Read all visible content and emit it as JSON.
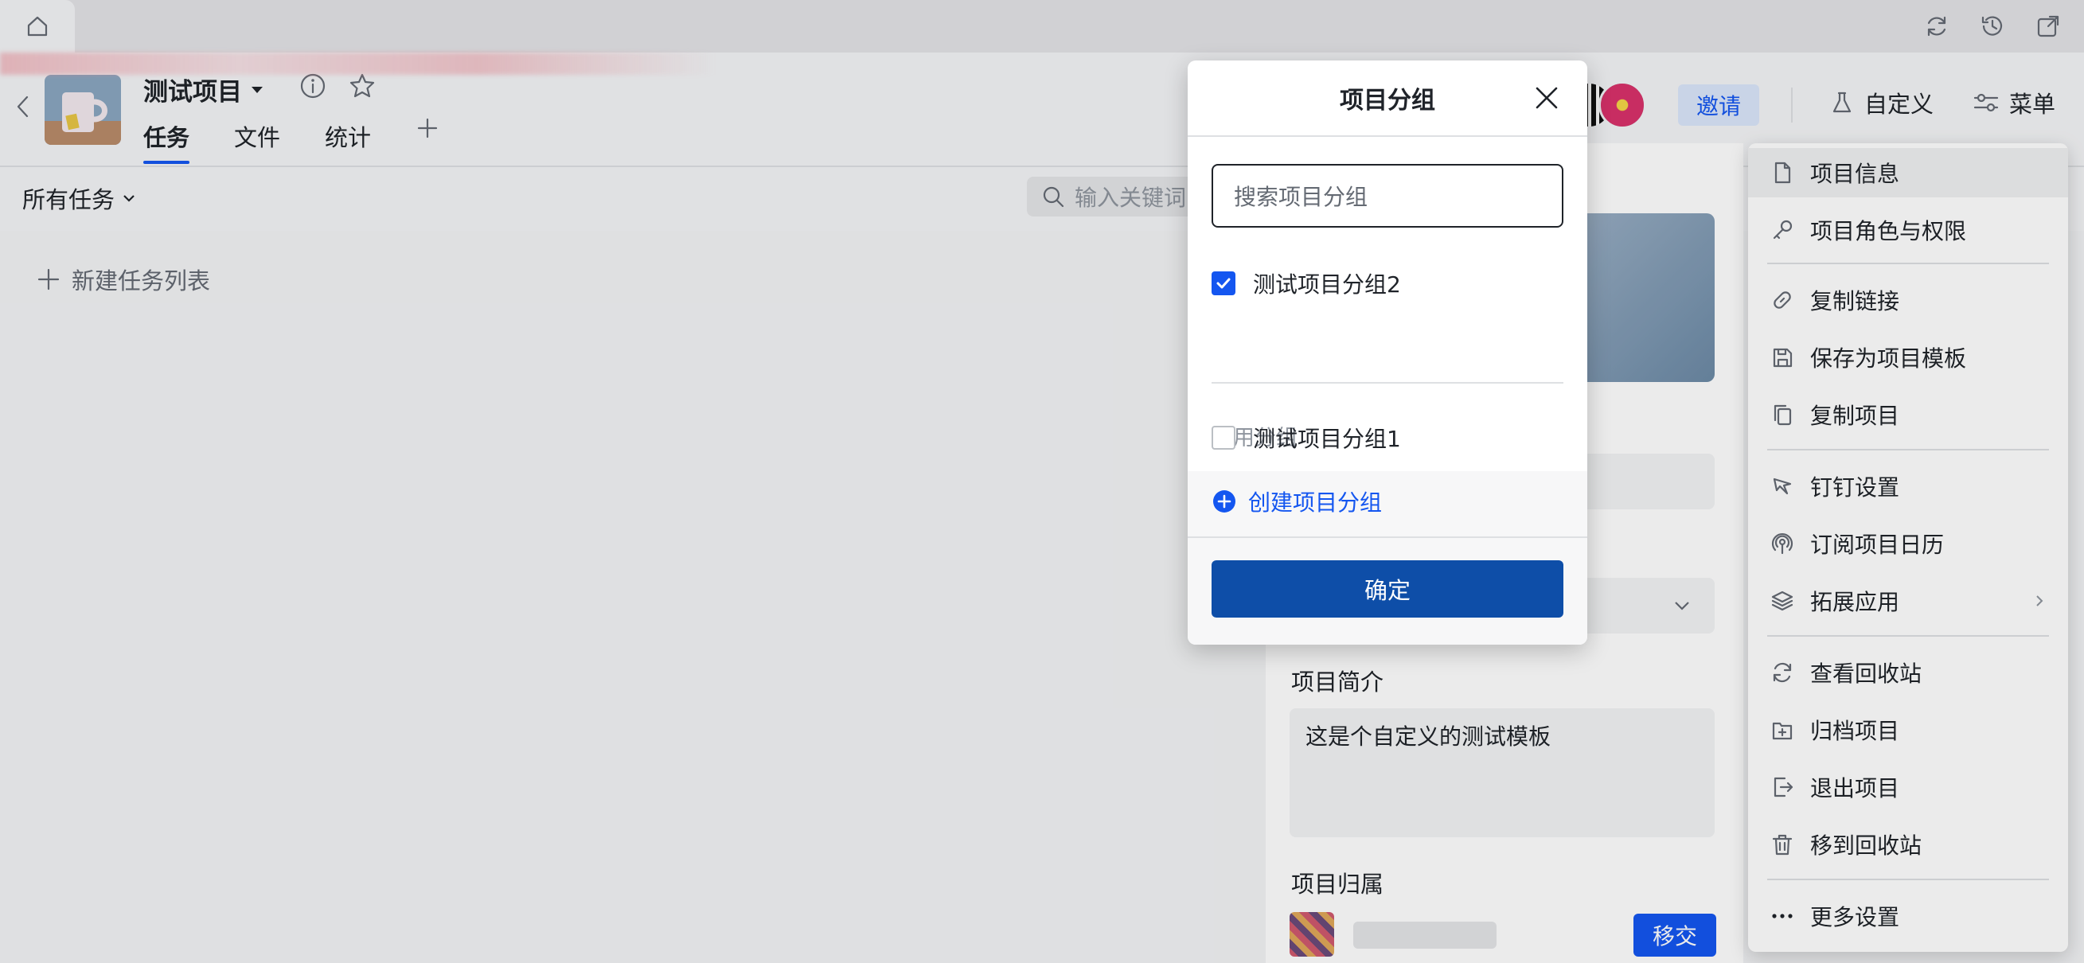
{
  "project": {
    "title": "测试项目",
    "tabs": [
      {
        "label": "任务",
        "active": true
      },
      {
        "label": "文件",
        "active": false
      },
      {
        "label": "统计",
        "active": false
      }
    ]
  },
  "header": {
    "invite_label": "邀请",
    "customize_label": "自定义",
    "menu_label": "菜单"
  },
  "filter": {
    "all_tasks_label": "所有任务",
    "search_placeholder": "输入关键词"
  },
  "board": {
    "new_list_label": "新建任务列表"
  },
  "detail": {
    "intro_label": "项目简介",
    "intro_text": "这是个自定义的测试模板",
    "owner_label": "项目归属",
    "transfer_label": "移交"
  },
  "menu": {
    "items": [
      {
        "label": "项目信息",
        "icon": "file-icon"
      },
      {
        "label": "项目角色与权限",
        "icon": "key-icon"
      },
      {
        "label": "复制链接",
        "icon": "link-icon"
      },
      {
        "label": "保存为项目模板",
        "icon": "save-icon"
      },
      {
        "label": "复制项目",
        "icon": "copy-icon"
      },
      {
        "label": "钉钉设置",
        "icon": "pin-icon"
      },
      {
        "label": "订阅项目日历",
        "icon": "broadcast-icon"
      },
      {
        "label": "拓展应用",
        "icon": "layers-icon"
      },
      {
        "label": "查看回收站",
        "icon": "refresh-icon"
      },
      {
        "label": "归档项目",
        "icon": "archive-icon"
      },
      {
        "label": "退出项目",
        "icon": "exit-icon"
      },
      {
        "label": "移到回收站",
        "icon": "trash-icon"
      },
      {
        "label": "更多设置",
        "icon": "more-icon"
      }
    ]
  },
  "dialog": {
    "title": "项目分组",
    "search_placeholder": "搜索项目分组",
    "selected_group": {
      "label": "测试项目分组2",
      "checked": true
    },
    "common_section_label": "常用分组",
    "common_group": {
      "label": "测试项目分组1",
      "checked": false
    },
    "create_label": "创建项目分组",
    "confirm_label": "确定"
  },
  "colors": {
    "accent": "#1456f0",
    "confirm": "#0e4ea8"
  }
}
